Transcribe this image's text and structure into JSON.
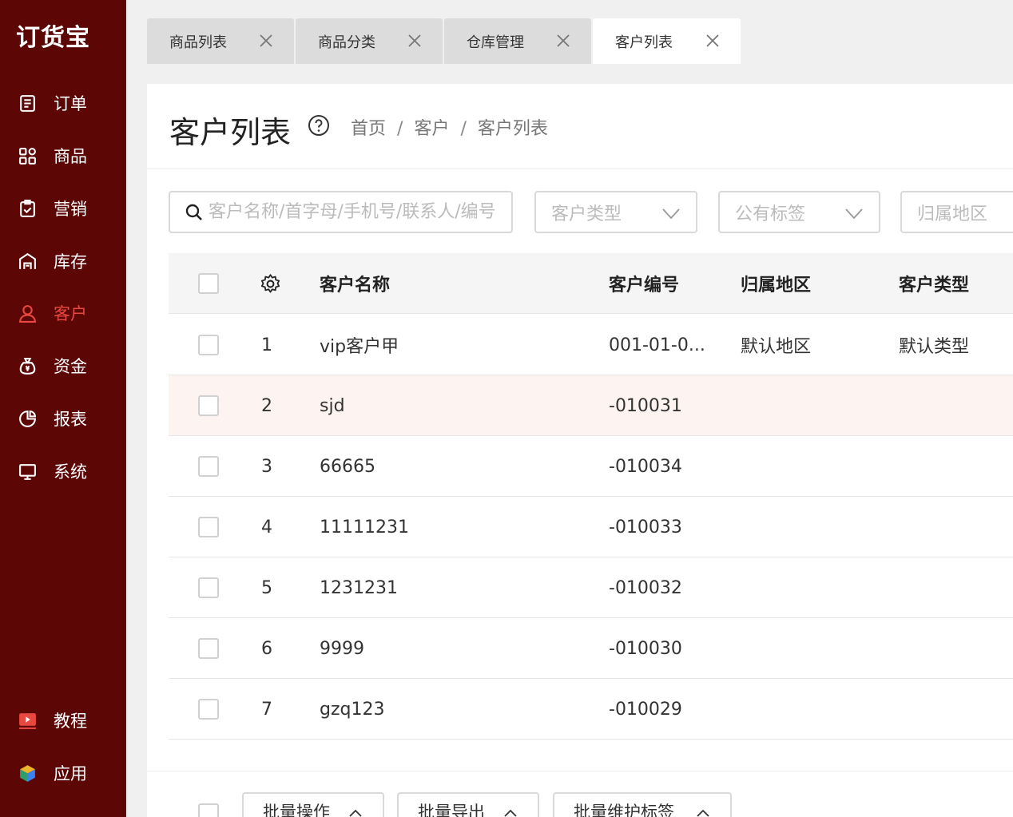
{
  "app": {
    "logo": "订货宝"
  },
  "sidebar": {
    "items": [
      {
        "label": "订单",
        "icon": "order-icon"
      },
      {
        "label": "商品",
        "icon": "grid-icon"
      },
      {
        "label": "营销",
        "icon": "clipboard-check-icon"
      },
      {
        "label": "库存",
        "icon": "warehouse-icon"
      },
      {
        "label": "客户",
        "icon": "user-icon",
        "active": true
      },
      {
        "label": "资金",
        "icon": "money-bag-icon"
      },
      {
        "label": "报表",
        "icon": "pie-chart-icon"
      },
      {
        "label": "系统",
        "icon": "monitor-icon"
      }
    ],
    "bottom": [
      {
        "label": "教程",
        "icon": "video-icon"
      },
      {
        "label": "应用",
        "icon": "cube-icon"
      }
    ]
  },
  "tabs": [
    {
      "label": "商品列表"
    },
    {
      "label": "商品分类"
    },
    {
      "label": "仓库管理"
    },
    {
      "label": "客户列表",
      "active": true
    }
  ],
  "page": {
    "title": "客户列表",
    "breadcrumb": [
      "首页",
      "客户",
      "客户列表"
    ],
    "breadcrumb_sep": "/"
  },
  "filters": {
    "search_placeholder": "客户名称/首字母/手机号/联系人/编号",
    "customer_type": "客户类型",
    "public_tag": "公有标签",
    "region": "归属地区"
  },
  "table": {
    "headers": {
      "name": "客户名称",
      "code": "客户编号",
      "region": "归属地区",
      "type": "客户类型"
    },
    "rows": [
      {
        "no": "1",
        "name": "vip客户甲",
        "code": "001-01-0...",
        "region": "默认地区",
        "type": "默认类型"
      },
      {
        "no": "2",
        "name": "sjd",
        "code": "-010031",
        "region": "",
        "type": ""
      },
      {
        "no": "3",
        "name": "66665",
        "code": "-010034",
        "region": "",
        "type": ""
      },
      {
        "no": "4",
        "name": "11111231",
        "code": "-010033",
        "region": "",
        "type": ""
      },
      {
        "no": "5",
        "name": "1231231",
        "code": "-010032",
        "region": "",
        "type": ""
      },
      {
        "no": "6",
        "name": "9999",
        "code": "-010030",
        "region": "",
        "type": ""
      },
      {
        "no": "7",
        "name": "gzq123",
        "code": "-010029",
        "region": "",
        "type": ""
      }
    ]
  },
  "footer": {
    "batch_ops": "批量操作",
    "batch_export": "批量导出",
    "batch_tags": "批量维护标签"
  },
  "colors": {
    "sidebar_bg": "#5c0606",
    "active": "#e8483f",
    "row_highlight": "#fdf4f1"
  }
}
